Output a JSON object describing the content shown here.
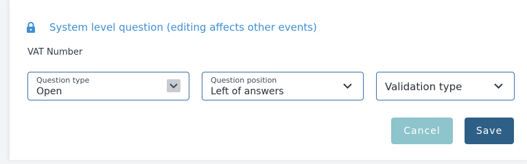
{
  "system_notice": {
    "icon": "lock-icon",
    "text": "System level question (editing affects other events)",
    "color": "#3e8fd4"
  },
  "question": {
    "title": "VAT Number"
  },
  "fields": {
    "question_type": {
      "label": "Question type",
      "value": "Open"
    },
    "question_position": {
      "label": "Question position",
      "value": "Left of answers"
    },
    "validation_type": {
      "placeholder": "Validation type"
    }
  },
  "buttons": {
    "cancel_label": "Cancel",
    "save_label": "Save"
  },
  "colors": {
    "border": "#3a6ea5",
    "cancel_bg": "#8ec4cc",
    "save_bg": "#2e5f86"
  }
}
